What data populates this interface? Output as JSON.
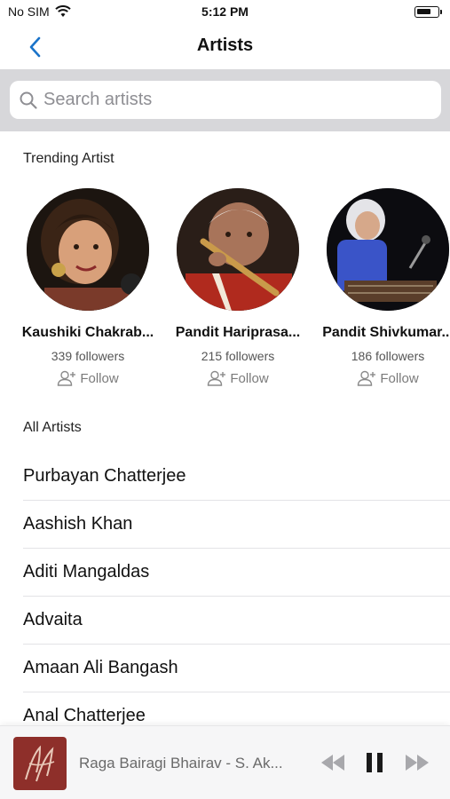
{
  "status": {
    "carrier": "No SIM",
    "time": "5:12 PM"
  },
  "nav": {
    "title": "Artists"
  },
  "search": {
    "placeholder": "Search artists"
  },
  "trending": {
    "heading": "Trending Artist",
    "artists": [
      {
        "name": "Kaushiki Chakrab...",
        "followers": "339 followers",
        "follow_label": "Follow"
      },
      {
        "name": "Pandit Hariprasa...",
        "followers": "215 followers",
        "follow_label": "Follow"
      },
      {
        "name": "Pandit Shivkumar...",
        "followers": "186 followers",
        "follow_label": "Follow"
      }
    ]
  },
  "all_artists": {
    "heading": "All Artists",
    "items": [
      "Purbayan Chatterjee",
      "Aashish Khan",
      "Aditi Mangaldas",
      "Advaita",
      "Amaan Ali Bangash",
      "Anal Chatterjee"
    ]
  },
  "player": {
    "track": "Raga Bairagi Bhairav - S. Ak..."
  },
  "colors": {
    "accent": "#1a73c9",
    "search_band": "#d7d7da",
    "muted_text": "#7a7a7a"
  }
}
